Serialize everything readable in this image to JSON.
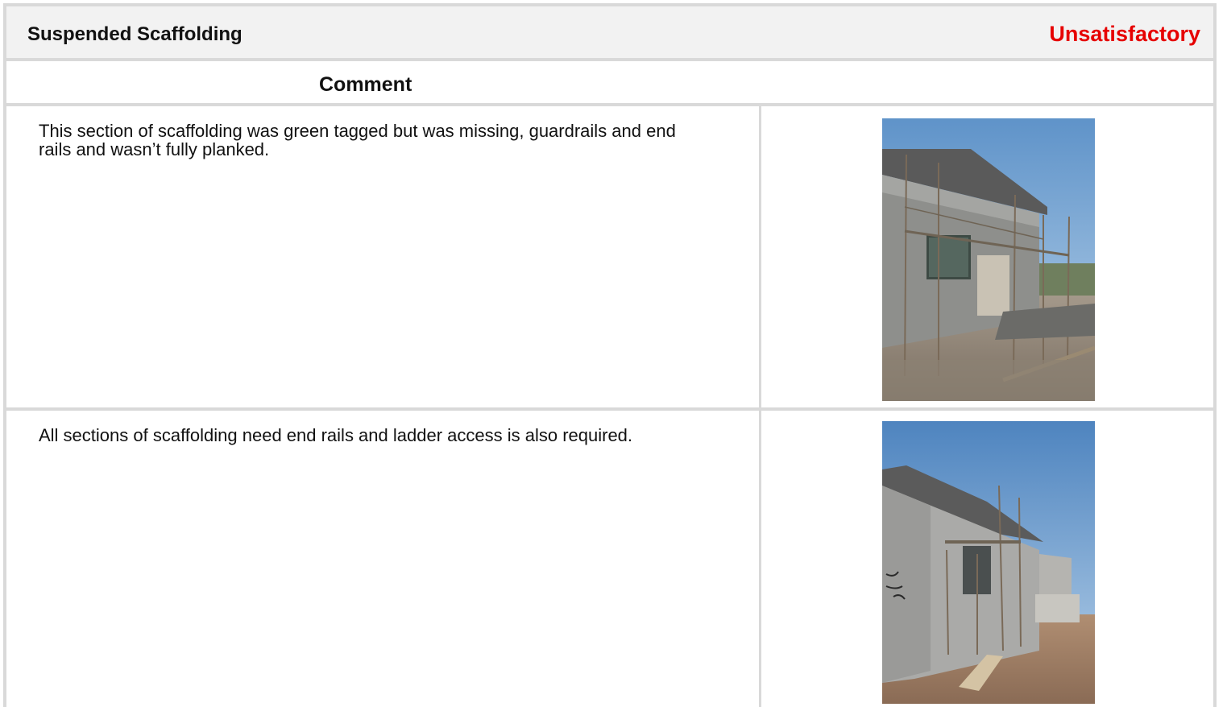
{
  "section": {
    "title": "Suspended Scaffolding",
    "status": "Unsatisfactory",
    "status_color": "#e60000"
  },
  "table": {
    "comment_header": "Comment"
  },
  "items": [
    {
      "comment": "This section of scaffolding was green tagged but was missing, guardrails and end rails and wasn’t fully planked.",
      "photo": "scaffolding-front-photo"
    },
    {
      "comment": "All sections of scaffolding need end rails and ladder access is also required.",
      "photo": "scaffolding-side-photo"
    }
  ]
}
